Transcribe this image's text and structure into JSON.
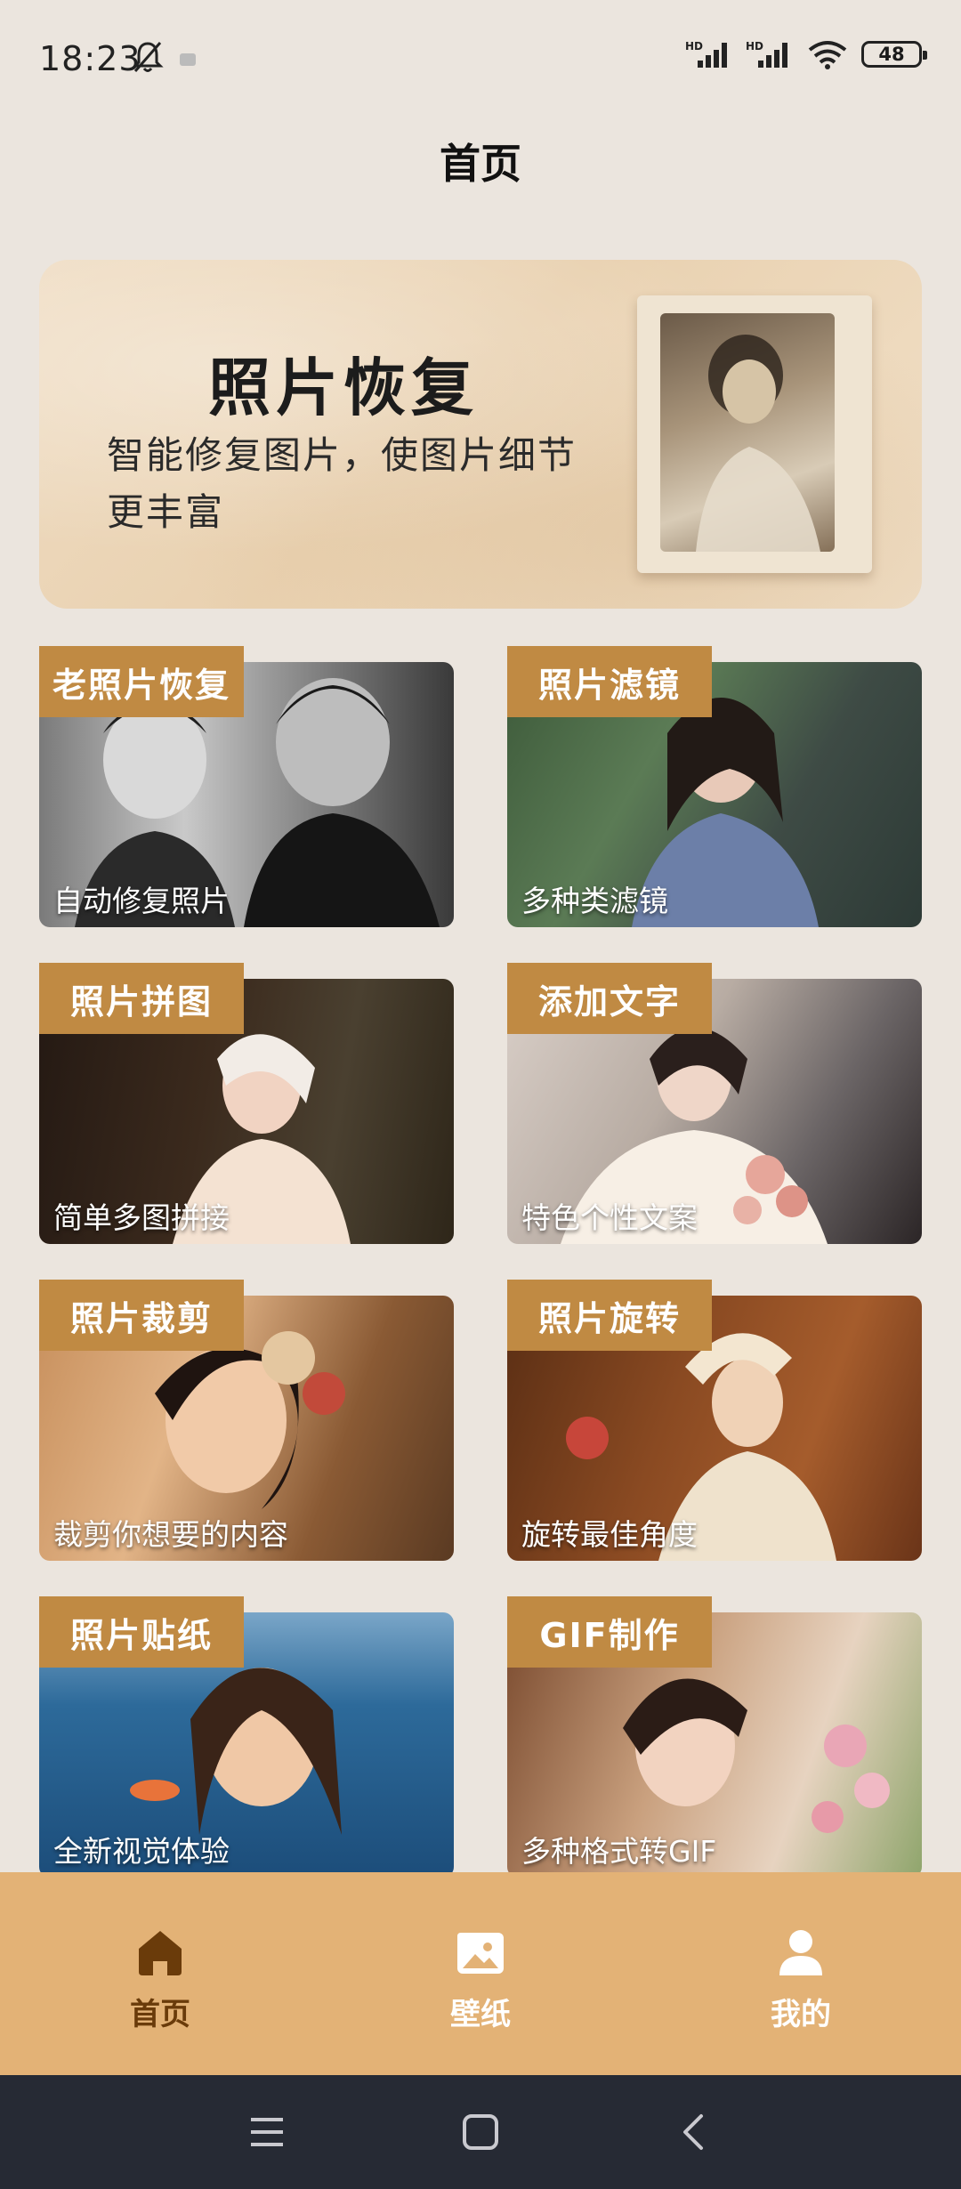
{
  "status_bar": {
    "time": "18:23",
    "battery": "48",
    "signal1_label": "HD",
    "signal2_label": "HD"
  },
  "page": {
    "title": "首页"
  },
  "banner": {
    "title": "照片恢复",
    "subtitle": "智能修复图片，使图片细节更丰富"
  },
  "features": [
    {
      "tag": "老照片恢复",
      "caption": "自动修复照片"
    },
    {
      "tag": "照片滤镜",
      "caption": "多种类滤镜"
    },
    {
      "tag": "照片拼图",
      "caption": "简单多图拼接"
    },
    {
      "tag": "添加文字",
      "caption": "特色个性文案"
    },
    {
      "tag": "照片裁剪",
      "caption": "裁剪你想要的内容"
    },
    {
      "tag": "照片旋转",
      "caption": "旋转最佳角度"
    },
    {
      "tag": "照片贴纸",
      "caption": "全新视觉体验"
    },
    {
      "tag": "GIF制作",
      "caption": "多种格式转GIF"
    }
  ],
  "bottom_nav": {
    "items": [
      {
        "label": "首页",
        "icon": "home-icon",
        "active": true
      },
      {
        "label": "壁纸",
        "icon": "image-icon",
        "active": false
      },
      {
        "label": "我的",
        "icon": "user-icon",
        "active": false
      }
    ]
  },
  "colors": {
    "accent": "#c08a43",
    "nav_bg": "#e3b276",
    "nav_active": "#6a3b0a",
    "page_bg": "#ebe5de"
  }
}
